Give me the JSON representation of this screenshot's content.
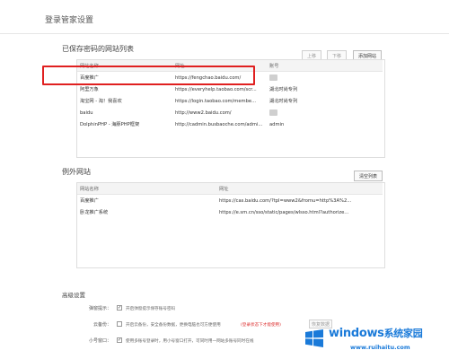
{
  "page": {
    "title": "登录管家设置"
  },
  "saved": {
    "title": "已保存密码的网站列表",
    "buttons": {
      "up": "上移",
      "down": "下移",
      "add": "添加网站"
    },
    "columns": [
      "网站名称",
      "网址",
      "账号"
    ],
    "rows": [
      {
        "name": "百度推广",
        "url": "https://fengchao.baidu.com/",
        "account": "",
        "account_blurred": true
      },
      {
        "name": "阿里万象",
        "url": "https://everyhelp.taobao.com/scr...",
        "account": "湖北时尚专列",
        "account_blurred": false
      },
      {
        "name": "淘宝网 - 淘！我喜欢",
        "url": "https://login.taobao.com/membe...",
        "account": "湖北时尚专列",
        "account_blurred": false
      },
      {
        "name": "baidu",
        "url": "http://www2.baidu.com/",
        "account": "",
        "account_blurred": true
      },
      {
        "name": "DolphinPHP - 海豚PHP框架",
        "url": "http://cadmin.busbaoche.com/admi...",
        "account": "admin",
        "account_blurred": false
      }
    ]
  },
  "exceptions": {
    "title": "例外网站",
    "clear_button": "清空列表",
    "columns": [
      "网站名称",
      "网址"
    ],
    "rows": [
      {
        "name": "百度推广",
        "url": "https://cas.baidu.com/?tpl=www2&fromu=http%3A%2..."
      },
      {
        "name": "卧龙推广系统",
        "url": "https://e.sm.cn/sso/static/pages/wlsso.html?authorize..."
      }
    ]
  },
  "advanced": {
    "title": "高级设置",
    "options": [
      {
        "label": "弹窗提示：",
        "checked": true,
        "text": "开启弹窗提示保存账号密码",
        "warn": ""
      },
      {
        "label": "云备份：",
        "checked": false,
        "text": "开启云备份，安全备份数据，更换电脑也可方便使用",
        "warn": "(登录状态下才能使用)"
      },
      {
        "label": "小号窗口：",
        "checked": true,
        "text": "使用多账号登录时，用小号窗口打开，可同时用一网站多账号同时在线",
        "warn": ""
      }
    ],
    "small_button": "恢复数据"
  },
  "watermark": {
    "title": "windows",
    "title_cn": "系统家园",
    "url": "www.ruihaitu.com"
  },
  "colors": {
    "highlight": "#e02020",
    "watermark": "#1a7ad9"
  }
}
